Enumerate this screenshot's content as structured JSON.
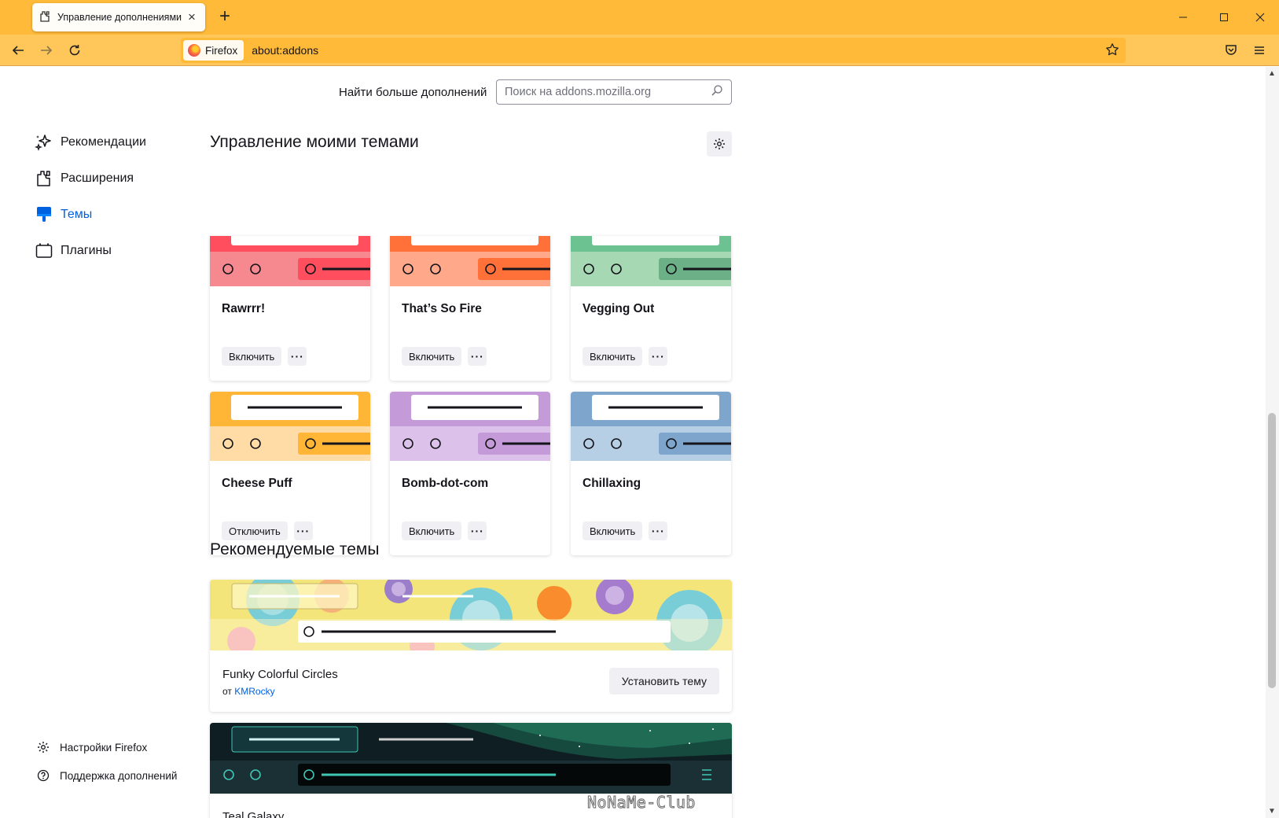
{
  "browser": {
    "tab_title": "Управление дополнениями",
    "identity_label": "Firefox",
    "url": "about:addons",
    "colors": {
      "tabbar": "#ffba3a",
      "navbar": "#ffc65a"
    }
  },
  "header": {
    "find_more_label": "Найти больше дополнений",
    "search_placeholder": "Поиск на addons.mozilla.org"
  },
  "sidebar": {
    "categories": [
      {
        "label": "Рекомендации",
        "icon": "sparkle-icon"
      },
      {
        "label": "Расширения",
        "icon": "puzzle-icon"
      },
      {
        "label": "Темы",
        "icon": "brush-icon",
        "selected": true
      },
      {
        "label": "Плагины",
        "icon": "plugin-icon"
      }
    ],
    "footer": [
      {
        "label": "Настройки Firefox",
        "icon": "gear-icon"
      },
      {
        "label": "Поддержка дополнений",
        "icon": "help-icon"
      }
    ]
  },
  "my_themes": {
    "title": "Управление моими темами",
    "themes": [
      {
        "name": "Rawrrr!",
        "action": "Включить",
        "color_top": "#ff4f5e",
        "color_bar": "#f5898f",
        "color_field": "#ff4f5e"
      },
      {
        "name": "That’s So Fire",
        "action": "Включить",
        "color_top": "#ff7139",
        "color_bar": "#ffa88a",
        "color_field": "#ff7139"
      },
      {
        "name": "Vegging Out",
        "action": "Включить",
        "color_top": "#6cc291",
        "color_bar": "#a6d8b4",
        "color_field": "#6cb088"
      },
      {
        "name": "Cheese Puff",
        "action": "Отключить",
        "color_top": "#ffb637",
        "color_bar": "#ffdba6",
        "color_field": "#ffb637"
      },
      {
        "name": "Bomb-dot-com",
        "action": "Включить",
        "color_top": "#c59ad8",
        "color_bar": "#dcc2ea",
        "color_field": "#c59ad8"
      },
      {
        "name": "Chillaxing",
        "action": "Включить",
        "color_top": "#7ea6cc",
        "color_bar": "#b7cfe5",
        "color_field": "#7ea6cc"
      }
    ],
    "more_label": "···"
  },
  "recommended": {
    "title": "Рекомендуемые темы",
    "themes": [
      {
        "name": "Funky Colorful Circles",
        "by": "от",
        "author": "KMRocky",
        "install_label": "Установить тему"
      },
      {
        "name": "Teal Galaxy"
      }
    ]
  },
  "watermark": "NoNaMe-Club"
}
